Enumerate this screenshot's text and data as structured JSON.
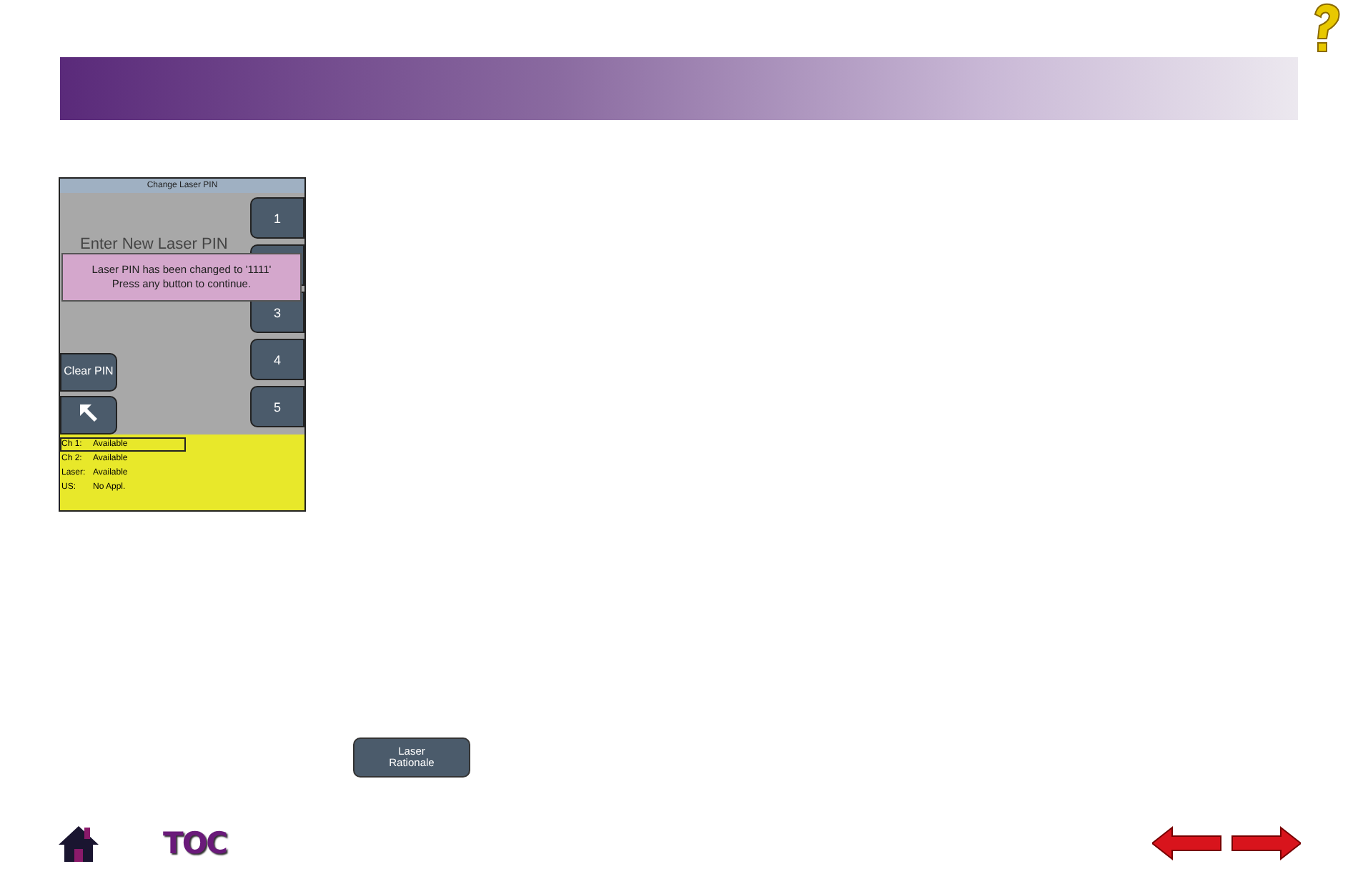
{
  "device_screen": {
    "title": "Change Laser PIN",
    "prompt": "Enter New Laser PIN",
    "keypad": [
      {
        "kind": "key",
        "label": "1"
      },
      {
        "kind": "covered"
      },
      {
        "kind": "key",
        "label": "3"
      },
      {
        "kind": "key",
        "label": "4"
      },
      {
        "kind": "key",
        "label": "5"
      }
    ],
    "clear_button": "Clear PIN",
    "dialog": {
      "lines": [
        "Laser PIN has been changed to '1111'",
        "Press any button to continue."
      ]
    },
    "status": [
      {
        "name": "Ch 1:",
        "value": "Available",
        "selected": true
      },
      {
        "name": "Ch 2:",
        "value": "Available",
        "selected": false
      },
      {
        "name": "Laser:",
        "value": "Available",
        "selected": false
      },
      {
        "name": "US:",
        "value": "No Appl.",
        "selected": false
      }
    ]
  },
  "rationale_button": "Laser Rationale",
  "footer": {
    "toc": "TOC"
  }
}
